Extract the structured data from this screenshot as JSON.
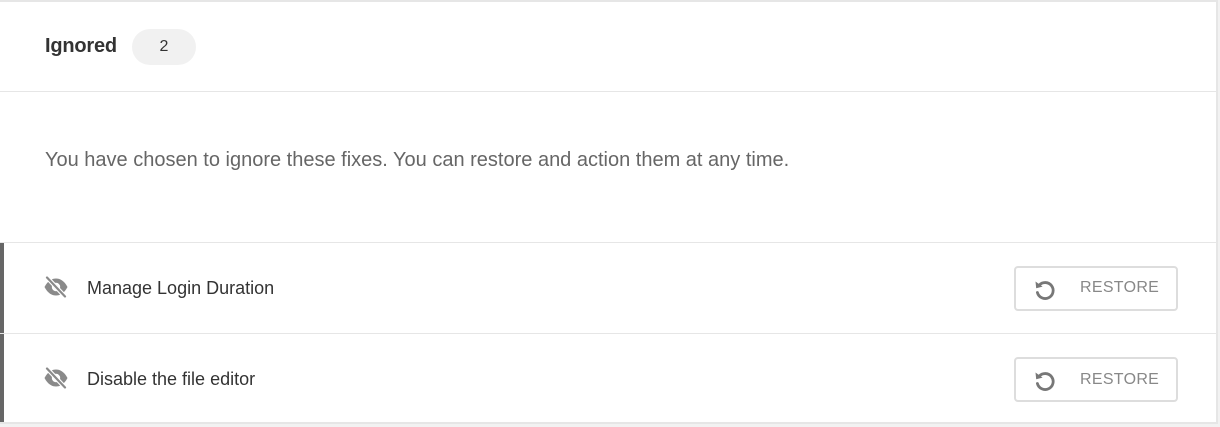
{
  "header": {
    "title": "Ignored",
    "count": "2"
  },
  "description": "You have chosen to ignore these fixes. You can restore and action them at any time.",
  "items": [
    {
      "label": "Manage Login Duration",
      "button_label": "RESTORE",
      "icon": "eye-slash-icon"
    },
    {
      "label": "Disable the file editor",
      "button_label": "RESTORE",
      "icon": "eye-slash-icon"
    }
  ],
  "colors": {
    "accent_bar": "#666666",
    "text_primary": "#333333",
    "text_secondary": "#666666",
    "button_text": "#888888"
  }
}
